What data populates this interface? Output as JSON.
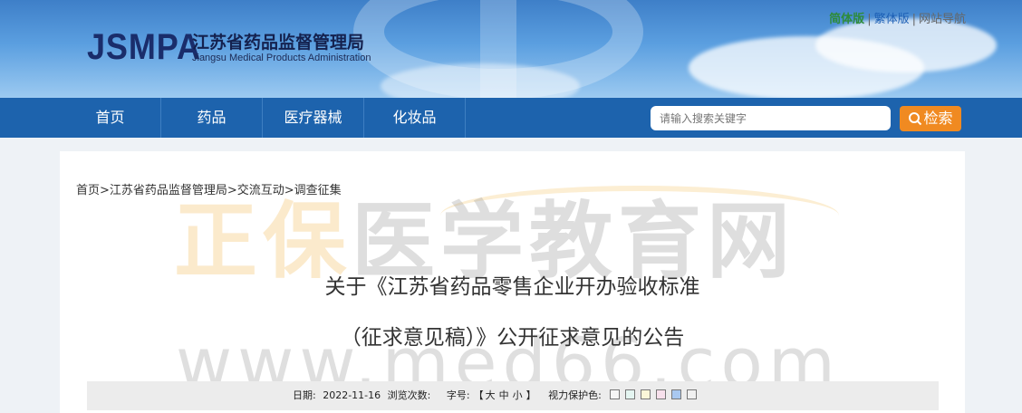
{
  "header": {
    "logo_en": "JSMPA",
    "logo_cn": "江苏省药品监督管理局",
    "logo_sub": "Jiangsu Medical Products Administration",
    "links": {
      "simplified": "简体版",
      "traditional": "繁体版",
      "sitemap": "网站导航",
      "separator": "|"
    }
  },
  "nav": {
    "items": [
      "首页",
      "药品",
      "医疗器械",
      "化妆品"
    ],
    "search_placeholder": "请输入搜索关键字",
    "search_button": "检索"
  },
  "breadcrumb": "首页>江苏省药品监督管理局>交流互动>调查征集",
  "watermark": {
    "text_orange": "正保",
    "text_gray": "医学教育网",
    "url": "www.med66.com"
  },
  "article": {
    "title_line1": "关于《江苏省药品零售企业开办验收标准",
    "title_line2": "（征求意见稿）》公开征求意见的公告"
  },
  "info": {
    "date_label": "日期:",
    "date_value": "2022-11-16",
    "views_label": "浏览次数:",
    "font_label": "字号:",
    "font_open": "【",
    "font_large": "大",
    "font_medium": "中",
    "font_small": "小",
    "font_close": "】",
    "eye_label": "视力保护色:"
  },
  "colors": {
    "nav_bg": "#1d63ad",
    "search_btn": "#f08a21",
    "swatches": [
      "#f6f6f6",
      "#e4f5f1",
      "#fbf7d8",
      "#f7e0ec",
      "#a9c8f0",
      "#f0f0f0"
    ]
  }
}
